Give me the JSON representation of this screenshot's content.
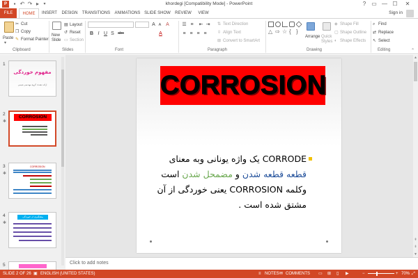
{
  "window": {
    "title": "khordegi [Compatibility Mode] - PowerPoint",
    "quick_access": [
      "save-icon",
      "undo-icon",
      "redo-icon",
      "start-from-beginning-icon",
      "customize-icon"
    ],
    "controls": {
      "help": "?",
      "restore_ribbon": "▭",
      "minimize": "—",
      "maximize": "☐",
      "close": "✕"
    }
  },
  "tabs": [
    {
      "label": "FILE"
    },
    {
      "label": "HOME"
    },
    {
      "label": "INSERT"
    },
    {
      "label": "DESIGN"
    },
    {
      "label": "TRANSITIONS"
    },
    {
      "label": "ANIMATIONS"
    },
    {
      "label": "SLIDE SHOW"
    },
    {
      "label": "REVIEW"
    },
    {
      "label": "VIEW"
    }
  ],
  "account": {
    "signin": "Sign in"
  },
  "ribbon": {
    "clipboard": {
      "paste": "Paste",
      "cut": "Cut",
      "copy": "Copy",
      "format_painter": "Format Painter",
      "label": "Clipboard"
    },
    "slides": {
      "new_slide": "New",
      "new_slide_2": "Slide",
      "layout": "Layout",
      "reset": "Reset",
      "section": "Section",
      "label": "Slides"
    },
    "font": {
      "label": "Font",
      "bold": "B",
      "italic": "I",
      "underline": "U",
      "shadow": "S",
      "strike": "abc",
      "grow": "A",
      "shrink": "A",
      "clear": "A",
      "color": "A"
    },
    "paragraph": {
      "text_direction": "Text Direction",
      "align_text": "Align Text",
      "convert": "Convert to SmartArt",
      "label": "Paragraph"
    },
    "drawing": {
      "arrange": "Arrange",
      "quick_styles": "Quick",
      "quick_styles_2": "Styles",
      "shape_fill": "Shape Fill",
      "shape_outline": "Shape Outline",
      "shape_effects": "Shape Effects",
      "label": "Drawing"
    },
    "editing": {
      "find": "Find",
      "replace": "Replace",
      "select": "Select",
      "label": "Editing"
    }
  },
  "thumbnails": [
    {
      "number": "1",
      "title": "مفهوم خوردگی",
      "subtitle": "ارائه دهنده: گروه مهندسی شیمی"
    },
    {
      "number": "2",
      "title": "CORROSION"
    },
    {
      "number": "3",
      "title": "CORROSION"
    },
    {
      "number": "4",
      "title": "پیشگیری از خوردگی"
    },
    {
      "number": "5"
    }
  ],
  "slide": {
    "title": "CORROSION",
    "line1_a": "CORRODE",
    "line1_b": " یک واژه یونانی وبه معنای",
    "line2_a": "قطعه قطعه شدن",
    "line2_b": " و ",
    "line2_c": "مضمحل شدن",
    "line2_d": " است",
    "line3_a": "وکلمه ",
    "line3_b": "CORROSION",
    "line3_c": " یعنی خوردگی از آن",
    "line4": "مشتق شده است ."
  },
  "notes": {
    "placeholder": "Click to add notes"
  },
  "status": {
    "slide_count": "SLIDE 2 OF 26",
    "language": "ENGLISH (UNITED STATES)",
    "notes_btn": "NOTES",
    "comments_btn": "COMMENTS",
    "zoom": "70%",
    "zoom_level": 0.7
  },
  "colors": {
    "accent": "#d24726",
    "title_fill": "#ff0000",
    "bullet": "#f2c100",
    "green_text": "#6aa84f",
    "blue_text": "#1f4e9a"
  }
}
